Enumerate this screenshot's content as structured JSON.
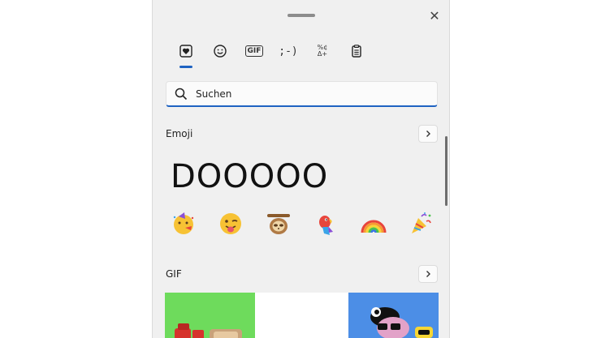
{
  "header": {
    "close_glyph": "✕"
  },
  "tabs": [
    {
      "name": "favorites",
      "icon": "heart-in-box-icon"
    },
    {
      "name": "emoji",
      "icon": "smiley-icon"
    },
    {
      "name": "gif",
      "label": "GIF"
    },
    {
      "name": "kaomoji",
      "label": ";-)"
    },
    {
      "name": "symbols",
      "label_top": "%¢",
      "label_bottom": "Δ+"
    },
    {
      "name": "clipboard",
      "icon": "clipboard-icon"
    }
  ],
  "search": {
    "placeholder": "Suchen"
  },
  "sections": {
    "emoji": {
      "title": "Emoji"
    },
    "gif": {
      "title": "GIF"
    }
  },
  "recent_text": "DOOOOO",
  "emojis": [
    "🥳",
    "😜",
    "🦥",
    "🦜",
    "🌈",
    "🎉"
  ],
  "colors": {
    "accent": "#1f63c2",
    "panel": "#f0f0f0",
    "gif1": "#6edb5c",
    "gif2": "#ffffff",
    "gif3": "#4c8ee6"
  }
}
